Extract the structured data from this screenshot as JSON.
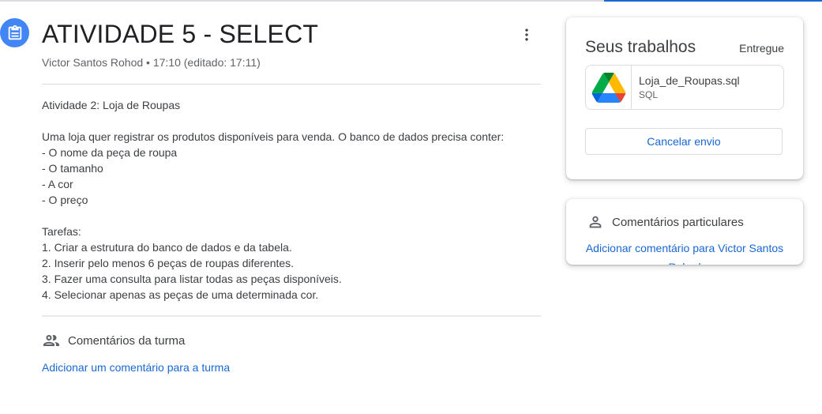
{
  "assignment": {
    "title": "ATIVIDADE 5 - SELECT",
    "meta": "Victor Santos Rohod • 17:10 (editado: 17:11)",
    "description": {
      "heading": "Atividade 2: Loja de Roupas",
      "intro": "Uma loja quer registrar os produtos disponíveis para venda. O banco de dados precisa conter:",
      "fields": [
        "- O nome da peça de roupa",
        "- O tamanho",
        "- A cor",
        "- O preço"
      ],
      "tasks_heading": "Tarefas:",
      "tasks": [
        "1. Criar a estrutura do banco de dados e da tabela.",
        "2. Inserir pelo menos 6 peças de roupas diferentes.",
        "3. Fazer uma consulta para listar todas as peças disponíveis.",
        "4. Selecionar apenas as peças de uma determinada cor."
      ]
    }
  },
  "class_comments": {
    "label": "Comentários da turma",
    "add_label": "Adicionar um comentário para a turma"
  },
  "your_work": {
    "title": "Seus trabalhos",
    "status": "Entregue",
    "attachment": {
      "name": "Loja_de_Roupas.sql",
      "type": "SQL",
      "icon": "google-drive-icon"
    },
    "unsubmit_label": "Cancelar envio"
  },
  "private_comments": {
    "label": "Comentários particulares",
    "add_label": "Adicionar comentário para Victor Santos Rohod"
  },
  "colors": {
    "accent": "#1967d2",
    "icon_bg": "#4285f4",
    "text": "#3c4043",
    "muted": "#5f6368",
    "divider": "#dadce0"
  }
}
